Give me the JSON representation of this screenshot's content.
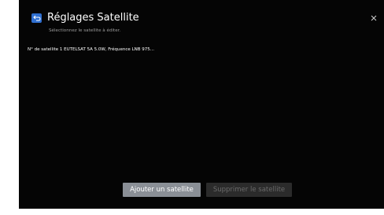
{
  "header": {
    "title": "Réglages Satellite",
    "subtitle": "Sélectionnez le satellite à éditer."
  },
  "satellite_list": [
    {
      "label": "N° de satellite 1 EUTELSAT 5A 5.0W, Fréquence LNB 975..."
    }
  ],
  "buttons": {
    "add_label": "Ajouter un satellite",
    "delete_label": "Supprimer le satellite",
    "delete_enabled": false
  },
  "icons": {
    "back": "back-arrow-icon",
    "close": "close-icon"
  },
  "colors": {
    "background": "#050505",
    "accent": "#2f6fd0",
    "add_button": "#8a8f96",
    "delete_button_disabled": "#2b2b2b"
  }
}
